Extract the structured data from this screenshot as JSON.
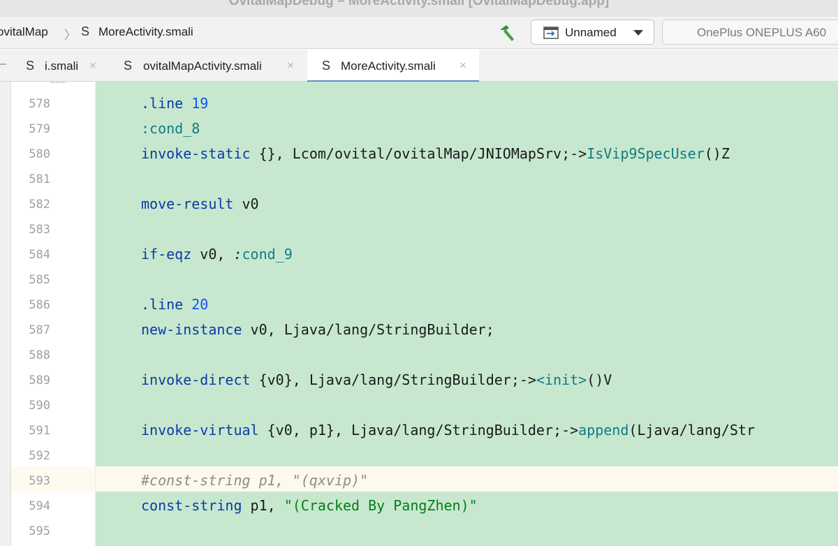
{
  "window": {
    "title": "OvitalMapDebug – MoreActivity.smali [OvitalMapDebug.app]"
  },
  "breadcrumb": {
    "project": "ovitalMap",
    "file_icon": "S",
    "file": "MoreActivity.smali"
  },
  "toolbar": {
    "build_icon": "hammer-icon",
    "run_config": "Unnamed",
    "device": "OnePlus ONEPLUS A60"
  },
  "tabs": [
    {
      "icon": "S",
      "label": "i.smali",
      "close": "×"
    },
    {
      "icon": "S",
      "label": "ovitalMapActivity.smali",
      "close": "×"
    },
    {
      "icon": "S",
      "label": "MoreActivity.smali",
      "close": "×",
      "active": true
    }
  ],
  "editor": {
    "caret_line": "593",
    "lines": [
      {
        "num": "578",
        "parts": [
          ".line",
          " ",
          "19"
        ]
      },
      {
        "num": "579",
        "text": ":cond_8"
      },
      {
        "num": "580",
        "parts": [
          "invoke-static",
          " {}, Lcom/ovital/ovitalMap/JNIOMapSrv;->",
          "IsVip9SpecUser",
          "()Z"
        ]
      },
      {
        "num": "581"
      },
      {
        "num": "582",
        "parts": [
          "move-result",
          " v0"
        ]
      },
      {
        "num": "583"
      },
      {
        "num": "584",
        "parts": [
          "if-eqz",
          " v0, ",
          ":",
          "cond_9"
        ]
      },
      {
        "num": "585"
      },
      {
        "num": "586",
        "parts": [
          ".line",
          " ",
          "20"
        ]
      },
      {
        "num": "587",
        "parts": [
          "new-instance",
          " v0, Ljava/lang/StringBuilder;"
        ]
      },
      {
        "num": "588"
      },
      {
        "num": "589",
        "parts": [
          "invoke-direct",
          " {v0}, Ljava/lang/StringBuilder;->",
          "<init>",
          "()V"
        ]
      },
      {
        "num": "590"
      },
      {
        "num": "591",
        "parts": [
          "invoke-virtual",
          " {v0, p1}, Ljava/lang/StringBuilder;->",
          "append",
          "(Ljava/lang/Str"
        ]
      },
      {
        "num": "592"
      },
      {
        "num": "593",
        "text": "#const-string p1, \"(qxvip)\""
      },
      {
        "num": "594",
        "parts": [
          "const-string",
          " p1, ",
          "\"(Cracked By PangZhen)\""
        ]
      },
      {
        "num": "595"
      }
    ]
  }
}
